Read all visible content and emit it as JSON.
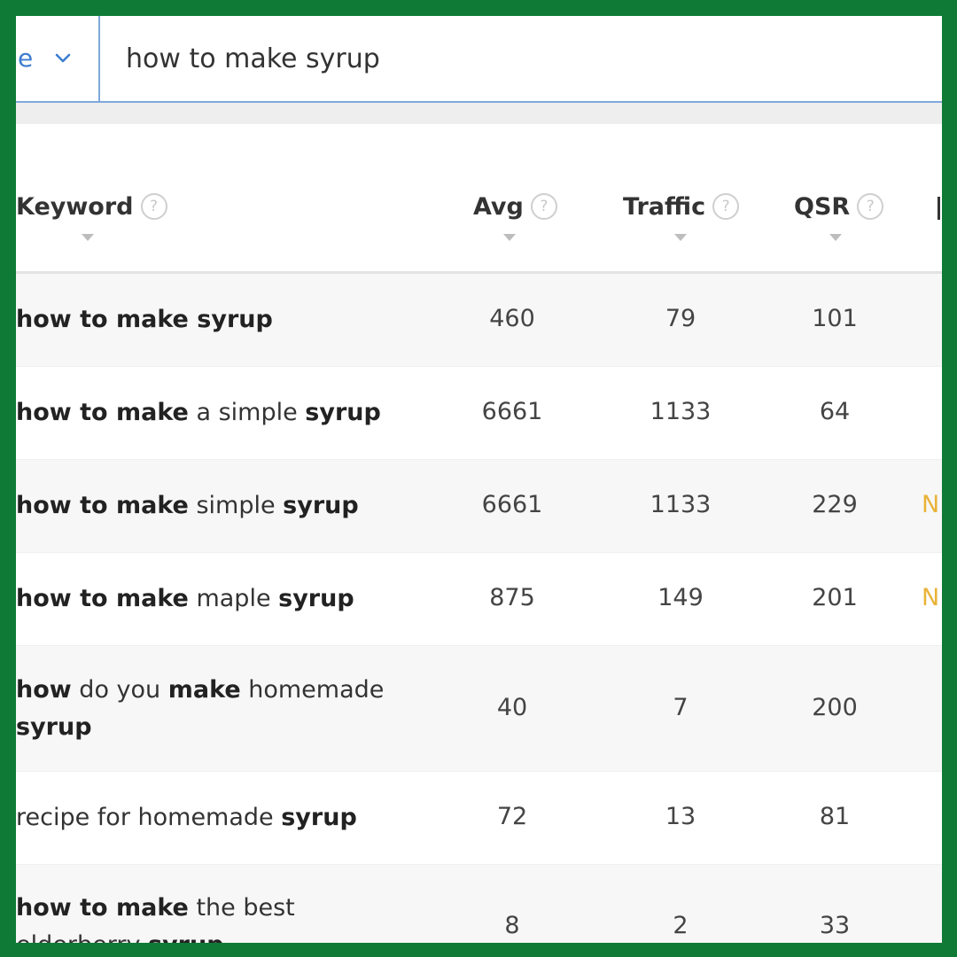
{
  "search": {
    "db_label": "e",
    "query": "how to make syrup"
  },
  "columns": {
    "keyword": "Keyword",
    "avg": "Avg",
    "traffic": "Traffic",
    "qsr": "QSR",
    "help_glyph": "?"
  },
  "rows": [
    {
      "keyword_parts": [
        {
          "text": "how to make syrup",
          "bold": true
        }
      ],
      "avg": "460",
      "traffic": "79",
      "qsr": "101",
      "extra": ""
    },
    {
      "keyword_parts": [
        {
          "text": "how to make",
          "bold": true
        },
        {
          "text": " a simple ",
          "bold": false
        },
        {
          "text": "syrup",
          "bold": true
        }
      ],
      "avg": "6661",
      "traffic": "1133",
      "qsr": "64",
      "extra": ""
    },
    {
      "keyword_parts": [
        {
          "text": "how to make",
          "bold": true
        },
        {
          "text": " simple ",
          "bold": false
        },
        {
          "text": "syrup",
          "bold": true
        }
      ],
      "avg": "6661",
      "traffic": "1133",
      "qsr": "229",
      "extra": "N"
    },
    {
      "keyword_parts": [
        {
          "text": "how to make",
          "bold": true
        },
        {
          "text": " maple ",
          "bold": false
        },
        {
          "text": "syrup",
          "bold": true
        }
      ],
      "avg": "875",
      "traffic": "149",
      "qsr": "201",
      "extra": "N"
    },
    {
      "keyword_parts": [
        {
          "text": "how",
          "bold": true
        },
        {
          "text": " do you ",
          "bold": false
        },
        {
          "text": "make",
          "bold": true
        },
        {
          "text": " homemade ",
          "bold": false
        },
        {
          "text": "syrup",
          "bold": true
        }
      ],
      "avg": "40",
      "traffic": "7",
      "qsr": "200",
      "extra": ""
    },
    {
      "keyword_parts": [
        {
          "text": "recipe for homemade ",
          "bold": false
        },
        {
          "text": "syrup",
          "bold": true
        }
      ],
      "avg": "72",
      "traffic": "13",
      "qsr": "81",
      "extra": ""
    },
    {
      "keyword_parts": [
        {
          "text": "how to make",
          "bold": true
        },
        {
          "text": " the best elderberry ",
          "bold": false
        },
        {
          "text": "syrup",
          "bold": true
        }
      ],
      "avg": "8",
      "traffic": "2",
      "qsr": "33",
      "extra": ""
    }
  ],
  "colors": {
    "frame": "#0f7a35",
    "accent": "#3d7dd0",
    "highlight": "#e8b339"
  }
}
